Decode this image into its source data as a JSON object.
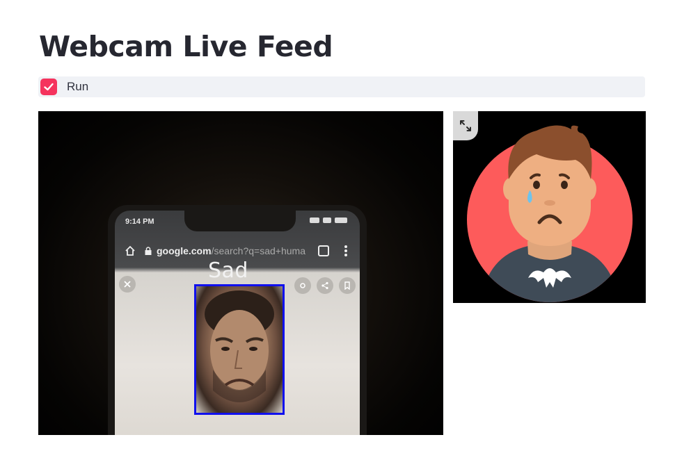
{
  "page": {
    "title": "Webcam Live Feed"
  },
  "controls": {
    "run_label": "Run",
    "run_checked": true
  },
  "feed": {
    "detected_emotion": "Sad",
    "phone_status_time": "9:14 PM",
    "phone_url_domain": "google.com",
    "phone_url_path": "/search?q=sad+huma"
  },
  "emoji": {
    "expand_icon": "fullscreen-expand-icon"
  },
  "colors": {
    "accent": "#f5335d",
    "box": "#1010ee",
    "emoji_bg": "#fd5b5b"
  }
}
